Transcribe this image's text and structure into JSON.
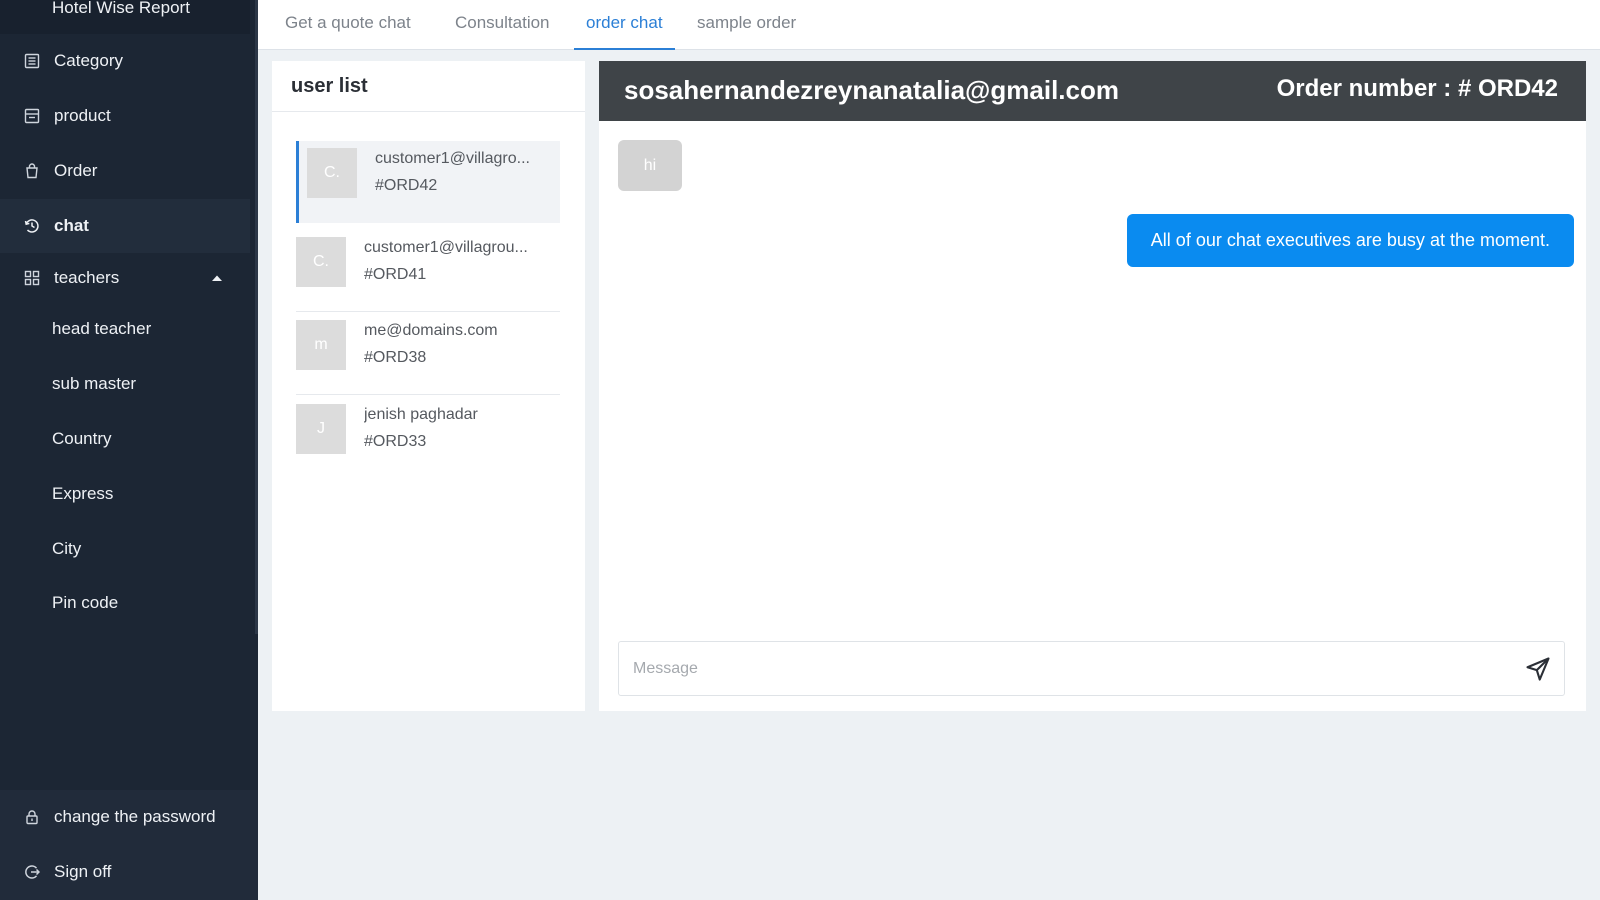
{
  "sidebar": {
    "top_item": "Hotel Wise Report",
    "items": [
      {
        "label": "Category",
        "icon": "list-icon"
      },
      {
        "label": "product",
        "icon": "box-icon"
      },
      {
        "label": "Order",
        "icon": "bag-icon"
      },
      {
        "label": "chat",
        "icon": "clock-icon",
        "active": true
      },
      {
        "label": "teachers",
        "icon": "grid-icon",
        "expanded": true
      }
    ],
    "subitems": [
      "head teacher",
      "sub master",
      "Country",
      "Express",
      "City",
      "Pin code"
    ],
    "bottom": [
      {
        "label": "change the password",
        "icon": "lock-icon"
      },
      {
        "label": "Sign off",
        "icon": "logout-icon"
      }
    ]
  },
  "tabs": [
    {
      "label": "Get a quote chat"
    },
    {
      "label": "Consultation"
    },
    {
      "label": "order chat",
      "active": true
    },
    {
      "label": "sample order"
    }
  ],
  "userlist": {
    "title": "user list",
    "users": [
      {
        "avatar": "C.",
        "email": "customer1@villagro...",
        "order": "#ORD42",
        "selected": true
      },
      {
        "avatar": "C.",
        "email": "customer1@villagrou...",
        "order": "#ORD41"
      },
      {
        "avatar": "m",
        "email": "me@domains.com",
        "order": "#ORD38"
      },
      {
        "avatar": "J",
        "email": "jenish paghadar",
        "order": "#ORD33"
      }
    ]
  },
  "chat": {
    "email": "sosahernandezreynanatalia@gmail.com",
    "order_label": "Order number : # ORD42",
    "messages": [
      {
        "direction": "incoming",
        "text": "hi"
      },
      {
        "direction": "outgoing",
        "text": "All of our chat executives are busy at the moment."
      }
    ],
    "composer_placeholder": "Message"
  },
  "colors": {
    "sidebar_bg": "#1c2634",
    "accent": "#2b7fd6",
    "outgoing_bubble": "#0a8bf0",
    "incoming_bubble": "#d3d3d3",
    "chat_header": "#3f4448"
  }
}
